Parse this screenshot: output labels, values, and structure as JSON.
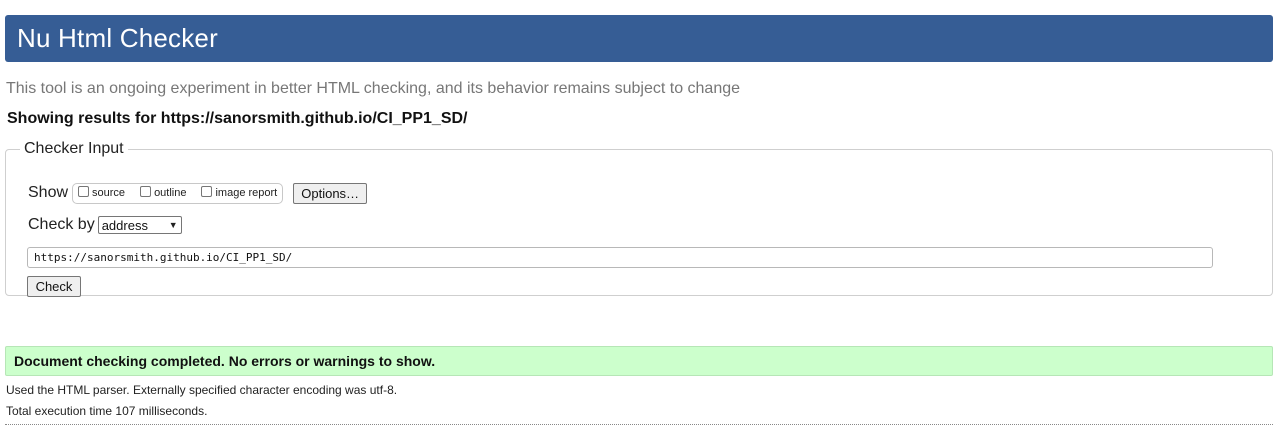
{
  "header": {
    "title": "Nu Html Checker"
  },
  "tagline": "This tool is an ongoing experiment in better HTML checking, and its behavior remains subject to change",
  "showing": "Showing results for https://sanorsmith.github.io/CI_PP1_SD/",
  "checker": {
    "legend": "Checker Input",
    "show_label": "Show",
    "options": [
      {
        "label": "source",
        "checked": false
      },
      {
        "label": "outline",
        "checked": false
      },
      {
        "label": "image report",
        "checked": false
      }
    ],
    "options_button": "Options…",
    "check_by_label": "Check by",
    "check_by_value": "address",
    "url_value": "https://sanorsmith.github.io/CI_PP1_SD/",
    "check_button": "Check"
  },
  "result": {
    "message": "Document checking completed. No errors or warnings to show.",
    "color": "#ccffcc"
  },
  "info": {
    "parser": "Used the HTML parser. Externally specified character encoding was utf-8.",
    "time": "Total execution time 107 milliseconds."
  },
  "colors": {
    "header_bg": "#365d95"
  }
}
